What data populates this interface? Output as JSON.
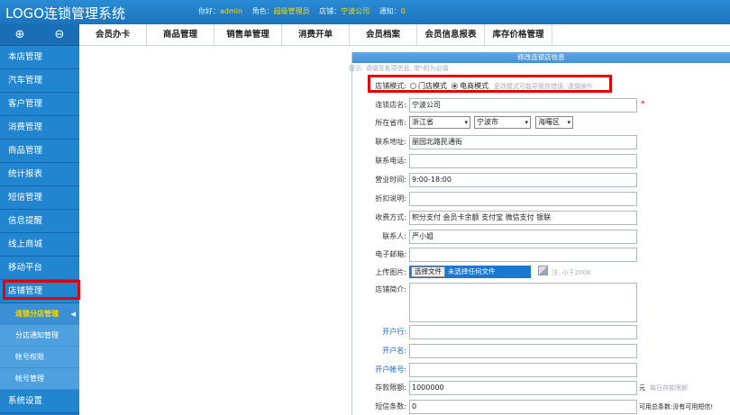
{
  "header": {
    "logo": "LOGO连锁管理系统",
    "hello_label": "你好：",
    "username": "admin",
    "role_label": "角色：",
    "role": "超级管理员",
    "store_label": "店铺：",
    "store": "宁波公司",
    "notice_label": "通知：",
    "notice_count": "0"
  },
  "sidebar": {
    "expand_icon": "⊕",
    "collapse_icon": "⊖",
    "items": [
      "本店管理",
      "汽车管理",
      "客户管理",
      "消费管理",
      "商品管理",
      "统计报表",
      "短信管理",
      "信息提醒",
      "线上商城",
      "移动平台",
      "店铺管理"
    ],
    "subitems": [
      "连锁分店管理",
      "分店通知管理",
      "帐号权限",
      "帐号管理"
    ],
    "bottom_item": "系统设置"
  },
  "topnav": {
    "tabs": [
      "会员办卡",
      "商品管理",
      "销售单管理",
      "消费开单",
      "会员档案",
      "会员信息报表",
      "库存价格管理"
    ]
  },
  "form": {
    "title": "修改连锁店信息",
    "hint": "提示: 请填写各项信息, 带*的为必填",
    "mode_label": "店铺模式:",
    "mode_store": "门店模式",
    "mode_ecommerce": "电商模式",
    "mode_note": "更改模式可能导致存错误, 谨慎操作",
    "name_label": "连锁店名:",
    "name_value": "宁波公司",
    "required": "*",
    "region_label": "所在省市:",
    "province": "浙江省",
    "city": "宁波市",
    "district": "海曙区",
    "address_label": "联系地址:",
    "address_value": "丽园北路民通街",
    "phone_label": "联系电话:",
    "phone_value": "",
    "hours_label": "营业时间:",
    "hours_value": "9:00-18:00",
    "discount_label": "折扣说明:",
    "discount_value": "",
    "payment_label": "收费方式:",
    "payment_value": "积分支付 会员卡余额 支付宝 微信支付 银联",
    "contact_label": "联系人:",
    "contact_value": "严小姐",
    "email_label": "电子邮箱:",
    "email_value": "",
    "upload_label": "上传图片:",
    "choose_file": "选择文件",
    "no_file": "未选择任何文件",
    "upload_note": "注: 小于200K",
    "intro_label": "店铺简介:",
    "intro_value": "",
    "bank_label": "开户行:",
    "bank_value": "",
    "account_name_label": "开户名:",
    "account_name_value": "",
    "account_no_label": "开户帐号:",
    "account_no_value": "",
    "limit_label": "存款限额:",
    "limit_value": "1000000",
    "limit_unit": "元",
    "limit_note": "每日存款限额",
    "sms_label": "短信条数:",
    "sms_value": "0",
    "sms_note": "可用总条数:没有可用短信!"
  }
}
